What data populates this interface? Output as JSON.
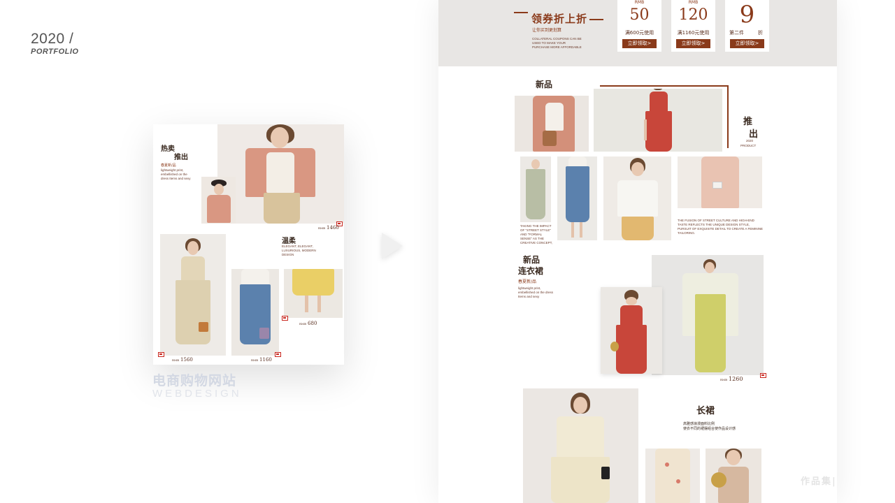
{
  "portfolio": {
    "year": "2020 /",
    "label": "PORTFOLIO"
  },
  "mockup": {
    "caption_cn": "电商购物网站",
    "caption_en": "WEBDESIGN",
    "hot_title_line1": "热卖",
    "hot_title_line2": "推出",
    "season_label": "春夏新/品",
    "hot_desc": "lightweight print, embellished on the dress Items and sexy",
    "price_1": "1460",
    "gentle_title": "温柔",
    "gentle_desc": "ELEGANT, ELEGANT, LUXURIOUS, MODERN DESIGN",
    "price_2": "680",
    "price_3": "1560",
    "price_4": "1160",
    "currency": "RMB"
  },
  "banner": {
    "title": "领券折上折",
    "subtitle": "让你买到更划算",
    "desc": "COLLATERAL COUPONS CAN BE USED TO MAKE YOUR PURCHASE MORE AFFORDABLE",
    "coupons": [
      {
        "currency": "RMB",
        "amount": "50",
        "condition": "满600元使用",
        "button": "立即领取>"
      },
      {
        "currency": "RMB",
        "amount": "120",
        "condition": "满1160元使用",
        "button": "立即领取>"
      },
      {
        "currency": "",
        "amount": "9",
        "condition_left": "第二件",
        "condition_right": "折",
        "button": "立即领取>"
      }
    ]
  },
  "new_section": {
    "title": "新品",
    "side_title_1": "推",
    "side_title_2": "出",
    "side_year": "2020",
    "side_en": "PRODUCT",
    "desc_left": "TAKING THE IMPACT OF \"STREET STYLE\" AND \"FORMAL SENSE\" AS THE CREATIVE CONCEPT,",
    "desc_right": "THE FUSION OF STREET CULTURE AND HIGH-END TASTE REFLECTS THE UNIQUE DESIGN STYLE, PURSUIT OF EXQUISITE DETAIL TO CREATE A FEMININE TAILORING."
  },
  "dress_section": {
    "title_1": "新品",
    "title_2": "连衣裙",
    "season_label": "春夏新/品",
    "desc": "lightweight print, embellished on the dress Items and sexy",
    "price": "1260",
    "currency": "RMB"
  },
  "long_section": {
    "title": "长裙",
    "desc_1": "高雅感浪漫面料比例",
    "desc_2": "使衣不同的裙摆组合使作品设计感"
  },
  "watermark": "作品集|",
  "colors": {
    "accent": "#8a3a1a",
    "banner_bg": "#e8e6e4",
    "tag_red": "#c8261e"
  }
}
